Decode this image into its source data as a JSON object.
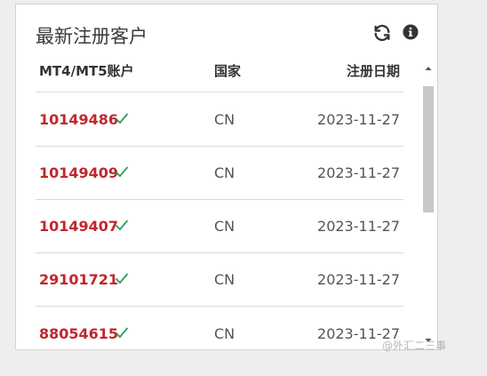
{
  "widget": {
    "title": "最新注册客户",
    "refresh_icon": "refresh-icon",
    "info_icon": "info-circle-icon"
  },
  "table": {
    "headers": {
      "account": "MT4/MT5账户",
      "country": "国家",
      "date": "注册日期"
    },
    "rows": [
      {
        "account": "10149486",
        "country": "CN",
        "date": "2023-11-27",
        "verified": true
      },
      {
        "account": "10149409",
        "country": "CN",
        "date": "2023-11-27",
        "verified": true
      },
      {
        "account": "10149407",
        "country": "CN",
        "date": "2023-11-27",
        "verified": true
      },
      {
        "account": "29101721",
        "country": "CN",
        "date": "2023-11-27",
        "verified": true
      },
      {
        "account": "88054615",
        "country": "CN",
        "date": "2023-11-27",
        "verified": true
      }
    ]
  },
  "watermark": "@外汇二三事",
  "colors": {
    "account_link": "#c1272d",
    "check_icon": "#2e9e5b",
    "title_text": "#3a3a3a",
    "scroll_thumb": "#c8c8c8"
  }
}
